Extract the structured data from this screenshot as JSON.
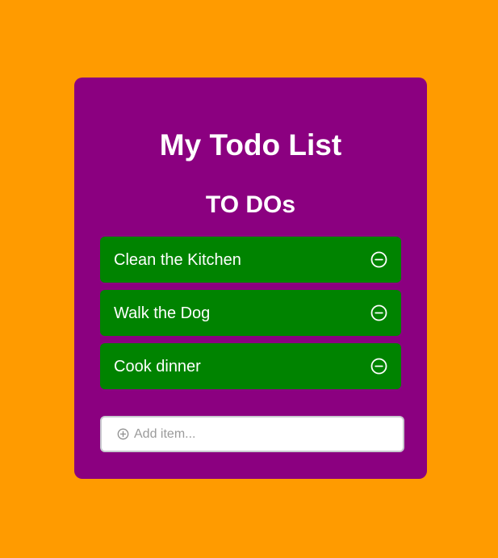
{
  "app": {
    "title": "My Todo List",
    "section_title": "TO DOs"
  },
  "todos": [
    {
      "text": "Clean the Kitchen",
      "action_icon": "minus-circle-icon"
    },
    {
      "text": "Walk the Dog",
      "action_icon": "minus-circle-icon"
    },
    {
      "text": "Cook dinner",
      "action_icon": "minus-circle-icon"
    }
  ],
  "add_item": {
    "icon": "plus-circle-icon",
    "placeholder": "Add item...",
    "value": ""
  },
  "colors": {
    "background": "#ff9b00",
    "card": "#8b0080",
    "todo_item": "#008300",
    "text": "#ffffff"
  }
}
